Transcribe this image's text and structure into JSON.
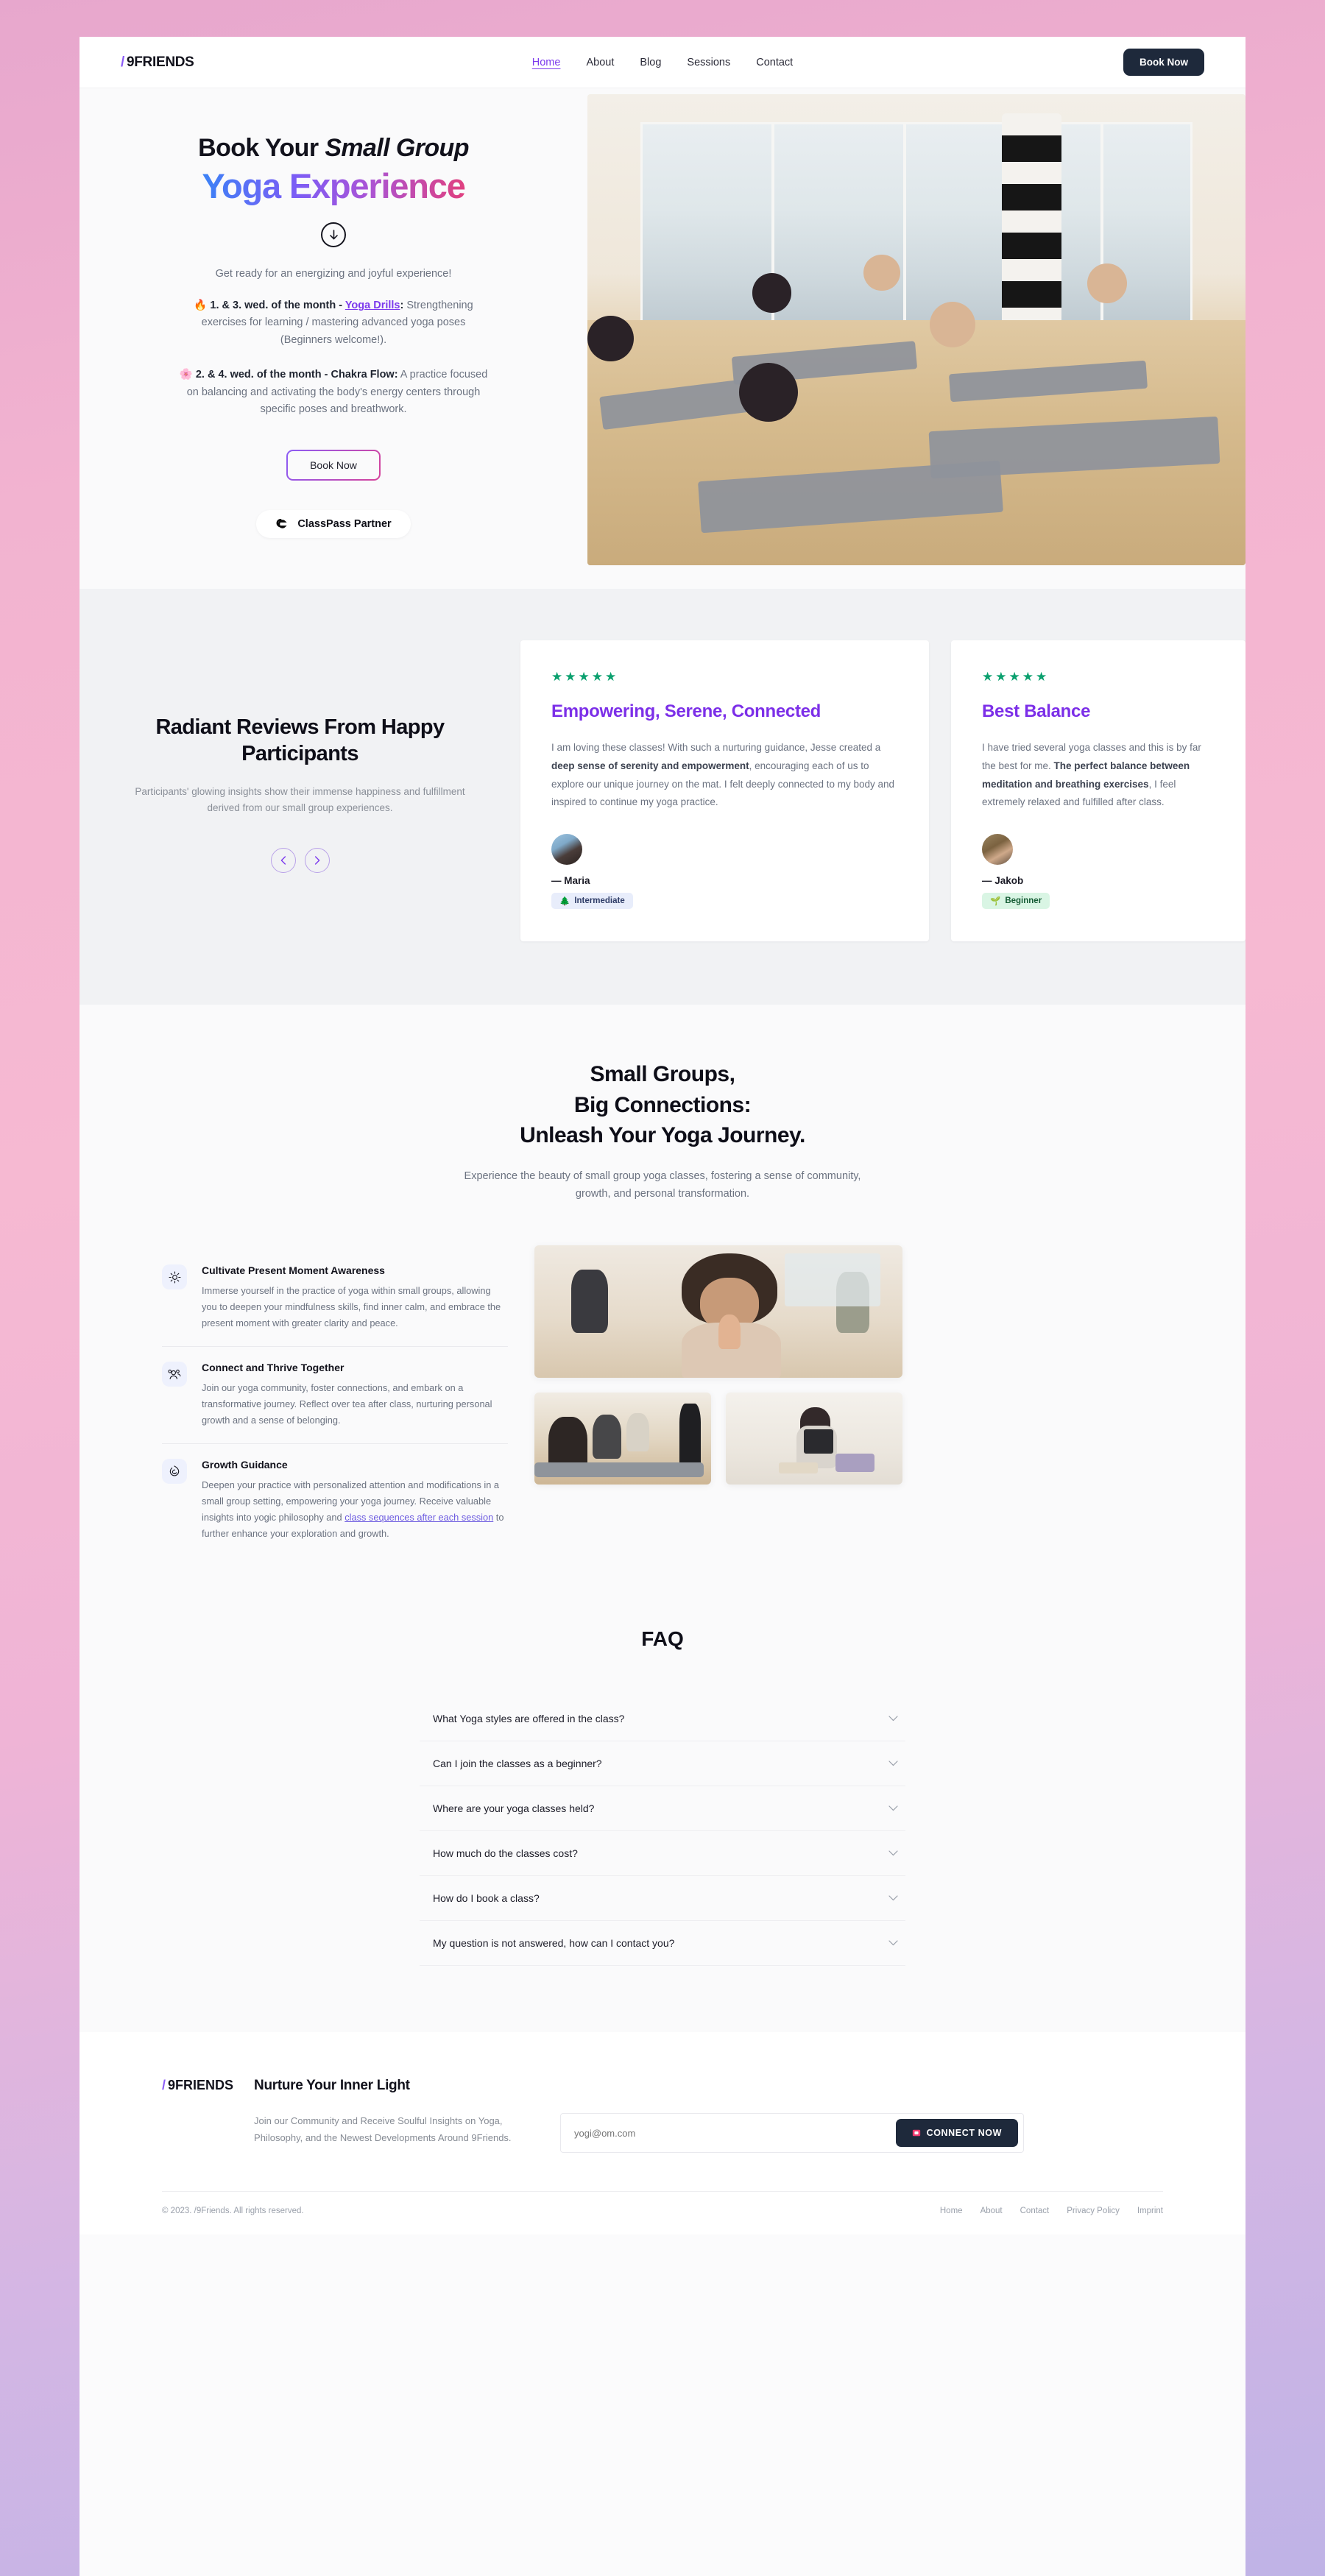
{
  "nav": {
    "logo_slash": "/",
    "logo": "9FRIENDS",
    "links": [
      {
        "label": "Home",
        "active": true
      },
      {
        "label": "About",
        "active": false
      },
      {
        "label": "Blog",
        "active": false
      },
      {
        "label": "Sessions",
        "active": false
      },
      {
        "label": "Contact",
        "active": false
      }
    ],
    "cta": "Book Now"
  },
  "hero": {
    "title_line1": "Book Your ",
    "title_line1_em": "Small Group",
    "title_line2": "Yoga Experience",
    "arrow_icon": "arrow-down-icon",
    "lead": "Get ready for an energizing and joyful experience!",
    "p1_emoji": "🔥",
    "p1_bold": "1. & 3. wed. of the month - ",
    "p1_link": "Yoga Drills",
    "p1_colon": ":",
    "p1_rest": " Strengthening exercises for learning / mastering advanced yoga poses (Beginners welcome!).",
    "p2_emoji": "🌸",
    "p2_bold": "2. & 4. wed. of the month - Chakra Flow:",
    "p2_rest": " A practice focused on balancing and activating the body's energy centers through specific poses and breathwork.",
    "book_label": "Book Now",
    "classpass_label": "ClassPass Partner",
    "classpass_icon": "classpass-logo-icon",
    "image_alt": "group-yoga-studio-photo"
  },
  "reviews": {
    "heading": "Radiant Reviews From Happy Participants",
    "sub": "Participants' glowing insights show their immense happiness and fulfillment derived from our small group experiences.",
    "prev_icon": "chevron-left-icon",
    "next_icon": "chevron-right-icon",
    "cards": [
      {
        "stars": "★★★★★",
        "rating": 5,
        "title": "Empowering, Serene, Connected",
        "body_1": "I am loving these classes! With such a nurturing guidance, Jesse created a ",
        "body_bold": "deep sense of serenity and empowerment",
        "body_2": ", encouraging each of us to explore our unique journey on the mat. I felt deeply connected to my body and inspired to continue my yoga practice.",
        "name": "— Maria",
        "badge_emoji": "🌲",
        "badge": "Intermediate"
      },
      {
        "stars": "★★★★★",
        "rating": 5,
        "title": "Best Balance",
        "body_1": "I have tried several yoga classes and this is by far the best for me. ",
        "body_bold": "The perfect balance between meditation and breathing exercises",
        "body_2": ", I feel extremely relaxed and fulfilled after class.",
        "name": "— Jakob",
        "badge_emoji": "🌱",
        "badge": "Beginner"
      }
    ]
  },
  "groups": {
    "heading_l1": "Small Groups,",
    "heading_l2": "Big Connections:",
    "heading_l3": "Unleash Your Yoga Journey.",
    "sub": "Experience the beauty of small group yoga classes, fostering a sense of community, growth, and personal transformation.",
    "features": [
      {
        "icon": "sun-icon",
        "title": "Cultivate Present Moment Awareness",
        "desc": "Immerse yourself in the practice of yoga within small groups, allowing you to deepen your mindfulness skills, find inner calm, and embrace the present moment with greater clarity and peace."
      },
      {
        "icon": "people-group-icon",
        "title": "Connect and Thrive Together",
        "desc": "Join our yoga community, foster connections, and embark on a transformative journey. Reflect over tea after class, nurturing personal growth and a sense of belonging."
      },
      {
        "icon": "flame-spiral-icon",
        "title": "Growth Guidance",
        "desc_1": "Deepen your practice with personalized attention and modifications in a small group setting, empowering your yoga journey. Receive valuable insights into yogic philosophy and ",
        "desc_link": "class sequences after each session",
        "desc_2": " to further enhance your exploration and growth."
      }
    ],
    "gallery": [
      {
        "alt": "woman-meditating-namaste-photo"
      },
      {
        "alt": "group-downward-dog-photo"
      },
      {
        "alt": "woman-reading-tablet-photo"
      }
    ]
  },
  "faq": {
    "heading": "FAQ",
    "chevron_icon": "chevron-down-icon",
    "items": [
      "What Yoga styles are offered in the class?",
      "Can I join the classes as a beginner?",
      "Where are your yoga classes held?",
      "How much do the classes cost?",
      "How do I book a class?",
      "My question is not answered, how can I contact you?"
    ]
  },
  "footer": {
    "logo_slash": "/",
    "logo": "9FRIENDS",
    "title": "Nurture Your Inner Light",
    "desc": "Join our Community and Receive Soulful Insights on Yoga, Philosophy, and the Newest Developments Around 9Friends.",
    "email_placeholder": "yogi@om.com",
    "email_value": "",
    "connect_icon": "mailbox-icon",
    "connect_label": "CONNECT NOW",
    "copyright": "© 2023. /9Friends. All rights reserved.",
    "links": [
      "Home",
      "About",
      "Contact",
      "Privacy Policy",
      "Imprint"
    ]
  },
  "colors": {
    "accent_purple": "#7c3aed",
    "accent_pink": "#d6439a",
    "accent_blue": "#3b82f6",
    "dark": "#1e293b",
    "star_green": "#0aa06e"
  }
}
